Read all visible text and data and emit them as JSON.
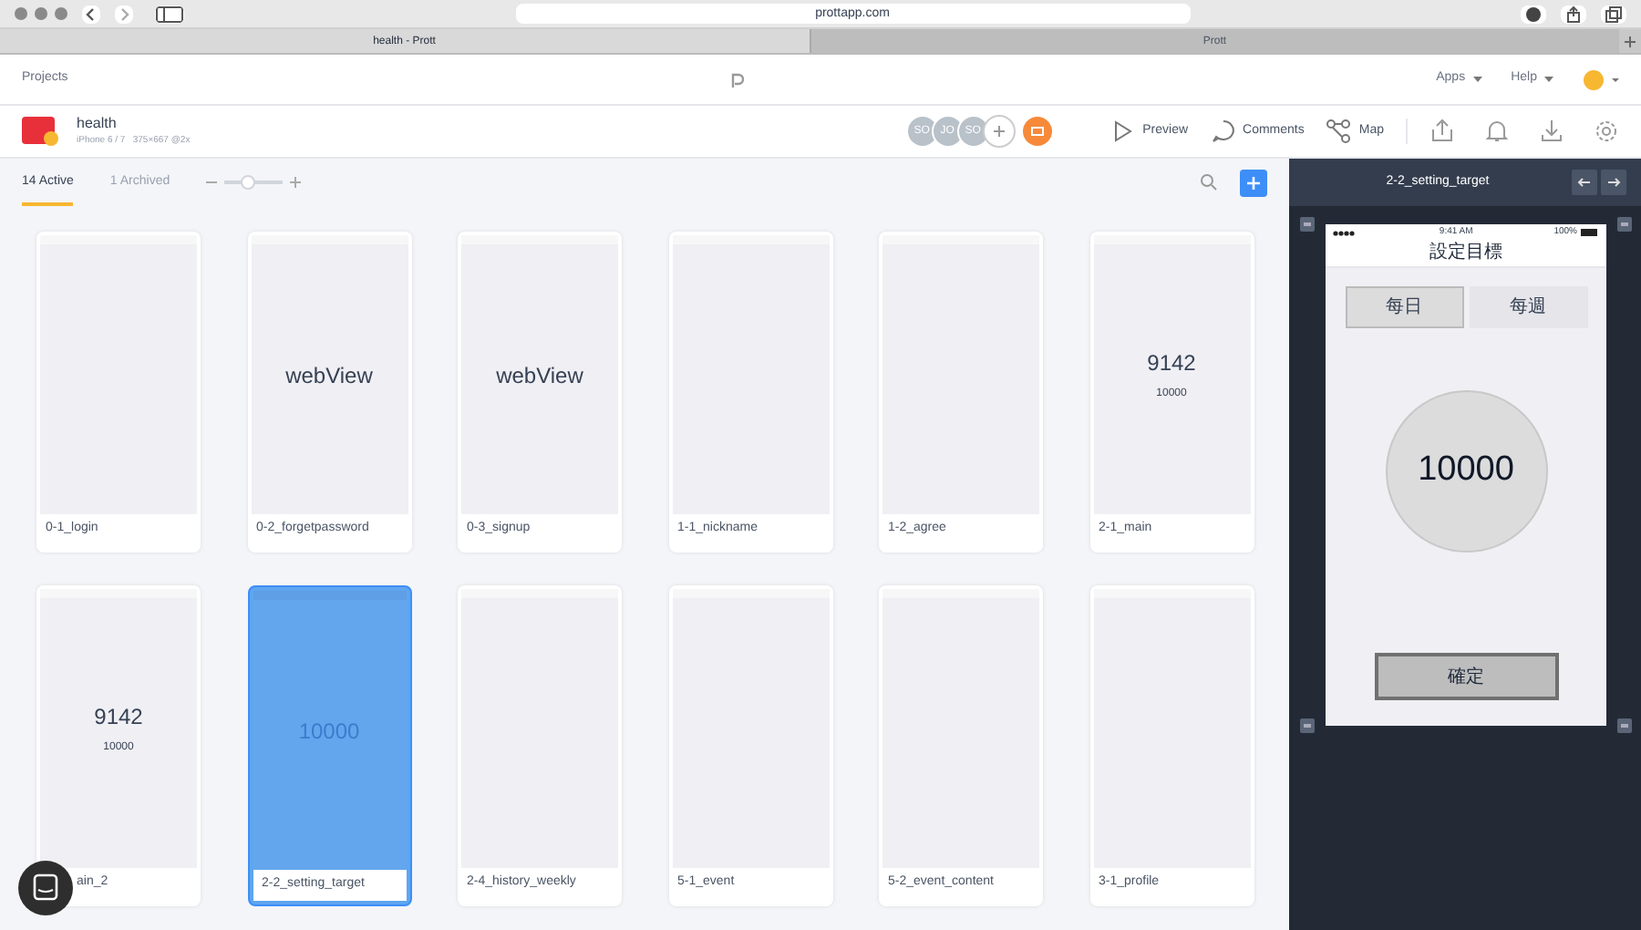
{
  "browser": {
    "url": "prottapp.com",
    "tabs": [
      {
        "label": "health - Prott",
        "selected": true
      },
      {
        "label": "Prott",
        "selected": false
      }
    ]
  },
  "header": {
    "projects_link": "Projects",
    "menus": [
      "Apps",
      "Help"
    ]
  },
  "project": {
    "name": "health",
    "device": "iPhone 6 / 7   375×667 @2x",
    "collaborators": [
      "SO",
      "JO",
      "SO"
    ],
    "actions": [
      "Preview",
      "Comments",
      "Map"
    ]
  },
  "toolbar": {
    "tabs": [
      {
        "label": "14 Active",
        "selected": true
      },
      {
        "label": "1 Archived",
        "selected": false
      }
    ],
    "zoom": {
      "level": 0.4
    }
  },
  "screens": [
    {
      "label": "0-1_login",
      "selected": false
    },
    {
      "label": "0-2_forgetpassword",
      "selected": false,
      "preview_texts": [
        "webView"
      ]
    },
    {
      "label": "0-3_signup",
      "selected": false,
      "preview_texts": [
        "webView"
      ]
    },
    {
      "label": "1-1_nickname",
      "selected": false
    },
    {
      "label": "1-2_agree",
      "selected": false
    },
    {
      "label": "2-1_main",
      "selected": false,
      "preview_texts": [
        "9142",
        "10000"
      ]
    },
    {
      "label": "ain_2",
      "selected": false,
      "preview_texts": [
        "9142",
        "10000"
      ]
    },
    {
      "label": "2-2_setting_target",
      "selected": true,
      "preview_texts": [
        "10000"
      ]
    },
    {
      "label": "2-4_history_weekly",
      "selected": false
    },
    {
      "label": "5-1_event",
      "selected": false
    },
    {
      "label": "5-2_event_content",
      "selected": false
    },
    {
      "label": "3-1_profile",
      "selected": false
    }
  ],
  "inspector": {
    "title": "2-2_setting_target",
    "phone": {
      "time": "9:41 AM",
      "battery": "100%",
      "screen_title": "設定目標",
      "segments": [
        {
          "label": "每日",
          "selected": true
        },
        {
          "label": "每週",
          "selected": false
        }
      ],
      "target": "10000",
      "confirm": "確定"
    }
  }
}
